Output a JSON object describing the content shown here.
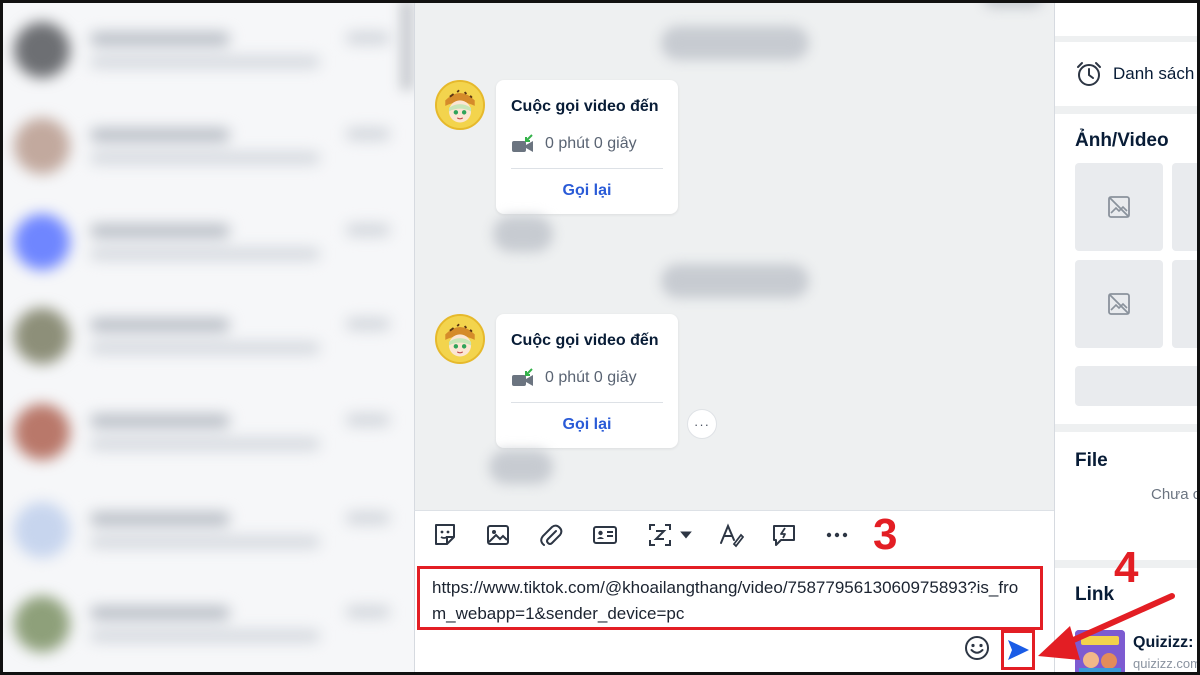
{
  "conversation_list": {
    "rows": [
      {
        "avatar_color": "#6d6f73"
      },
      {
        "avatar_color": "#c2a99e"
      },
      {
        "avatar_color": "#6f86ff"
      },
      {
        "avatar_color": "#8d8f79"
      },
      {
        "avatar_color": "#b9786a"
      },
      {
        "avatar_color": "#c7d5ee"
      },
      {
        "avatar_color": "#8ea07a"
      }
    ]
  },
  "chat": {
    "messages": [
      {
        "title": "Cuộc gọi video đến",
        "duration": "0 phút 0 giây",
        "action": "Gọi lại"
      },
      {
        "title": "Cuộc gọi video đến",
        "duration": "0 phút 0 giây",
        "action": "Gọi lại"
      }
    ],
    "more_options": "···"
  },
  "toolbar": {
    "icons": [
      "sticker-icon",
      "image-icon",
      "attachment-icon",
      "contact-card-icon",
      "screenshot-icon",
      "text-format-icon",
      "quick-message-icon",
      "more-icon"
    ],
    "step_label": "3"
  },
  "composer": {
    "input_value": "https://www.tiktok.com/@khoailangthang/video/7587795613060975893?is_from_webapp=1&sender_device=pc",
    "send_step_label": "4"
  },
  "info_panel": {
    "reminder_label": "Danh sách",
    "media_title": "Ảnh/Video",
    "file_title": "File",
    "file_empty": "Chưa c",
    "link_title": "Link",
    "link_item_title": "Quizizz:",
    "link_item_domain": "quizizz.com"
  },
  "colors": {
    "annotation_red": "#e31e24",
    "link_blue": "#2a5bd7",
    "send_blue": "#1a5ce6"
  }
}
